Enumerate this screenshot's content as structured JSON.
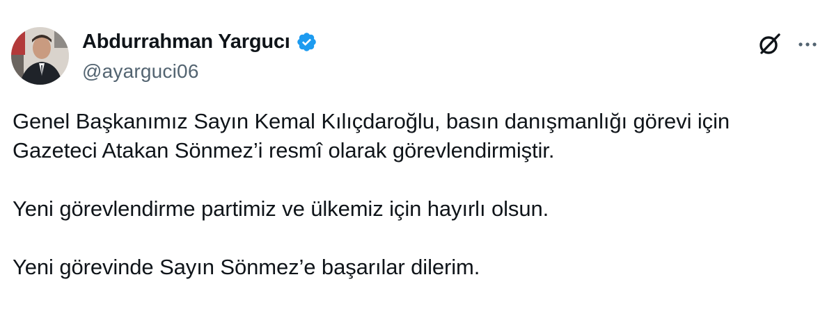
{
  "author": {
    "display_name": "Abdurrahman Yargucı",
    "handle": "@ayarguci06",
    "verified_color": "#1d9bf0"
  },
  "icons": {
    "verified": "verified-badge-icon",
    "grok": "grok-icon",
    "more": "more-horizontal-icon"
  },
  "tweet": {
    "paragraphs": [
      "Genel Başkanımız Sayın Kemal Kılıçdaroğlu, basın danışmanlığı görevi için Gazeteci Atakan Sönmez’i resmî olarak görevlendirmiştir.",
      "Yeni görevlendirme partimiz ve ülkemiz için hayırlı olsun.",
      "Yeni görevinde Sayın Sönmez’e başarılar dilerim."
    ]
  },
  "colors": {
    "text": "#0f1419",
    "secondary": "#536471",
    "background": "#ffffff"
  }
}
